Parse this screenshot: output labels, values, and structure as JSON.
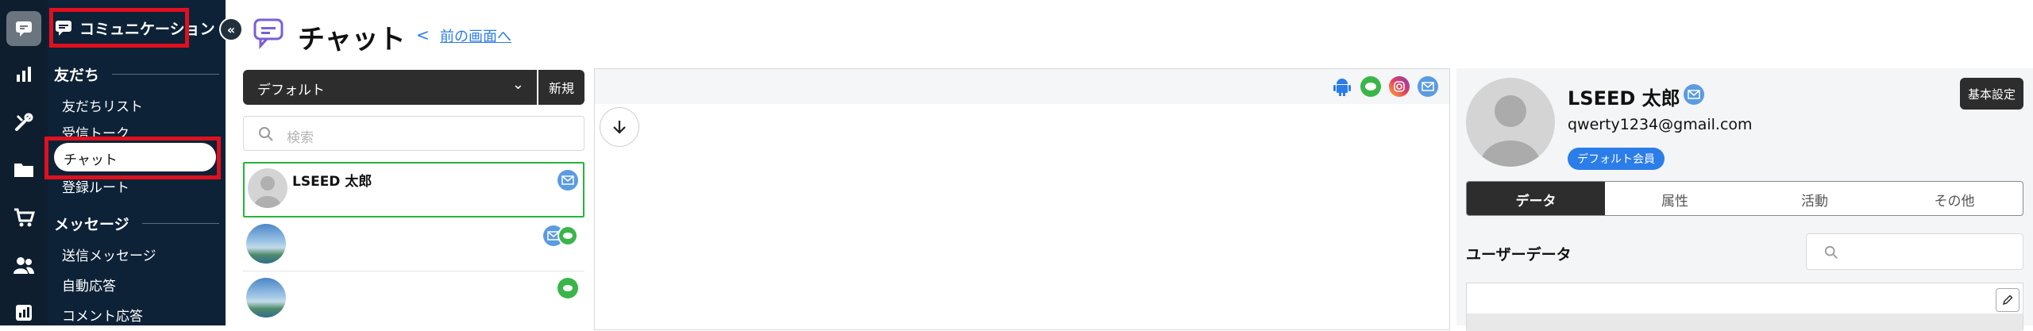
{
  "sidebar": {
    "section_title": "コミュニケーション",
    "groups": [
      {
        "heading": "友だち",
        "items": [
          "友だちリスト",
          "受信トーク",
          "チャット",
          "登録ルート"
        ]
      },
      {
        "heading": "メッセージ",
        "items": [
          "送信メッセージ",
          "自動応答",
          "コメント応答"
        ]
      }
    ],
    "active_item": "チャット"
  },
  "header": {
    "title": "チャット",
    "back_glyph": "<",
    "back_link": "前の画面へ"
  },
  "thread_list": {
    "folder_select": "デフォルト",
    "new_button": "新規",
    "search_placeholder": "検索",
    "threads": [
      {
        "name": "LSEED 太郎",
        "selected": true,
        "channels": [
          "mail-icon"
        ]
      },
      {
        "name": "",
        "selected": false,
        "channels": [
          "mail-icon",
          "line-icon"
        ]
      },
      {
        "name": "",
        "selected": false,
        "channels": [
          "line-icon"
        ]
      }
    ]
  },
  "chat_area": {
    "channel_icons": [
      "android-icon",
      "line-icon",
      "instagram-icon",
      "mail-icon"
    ]
  },
  "profile": {
    "name": "LSEED 太郎",
    "email": "qwerty1234@gmail.com",
    "badge": "デフォルト会員",
    "settings_button": "基本設定",
    "tabs": [
      "データ",
      "属性",
      "活動",
      "その他"
    ],
    "active_tab": "データ",
    "user_data_heading": "ユーザーデータ"
  },
  "colors": {
    "sidebar_bg": "#0d2237",
    "rail_bg": "#0f1e2e",
    "accent_blue": "#2b7de9",
    "line_green": "#3ab54a",
    "highlight_red": "#e0101e",
    "selected_border": "#27b43a"
  }
}
